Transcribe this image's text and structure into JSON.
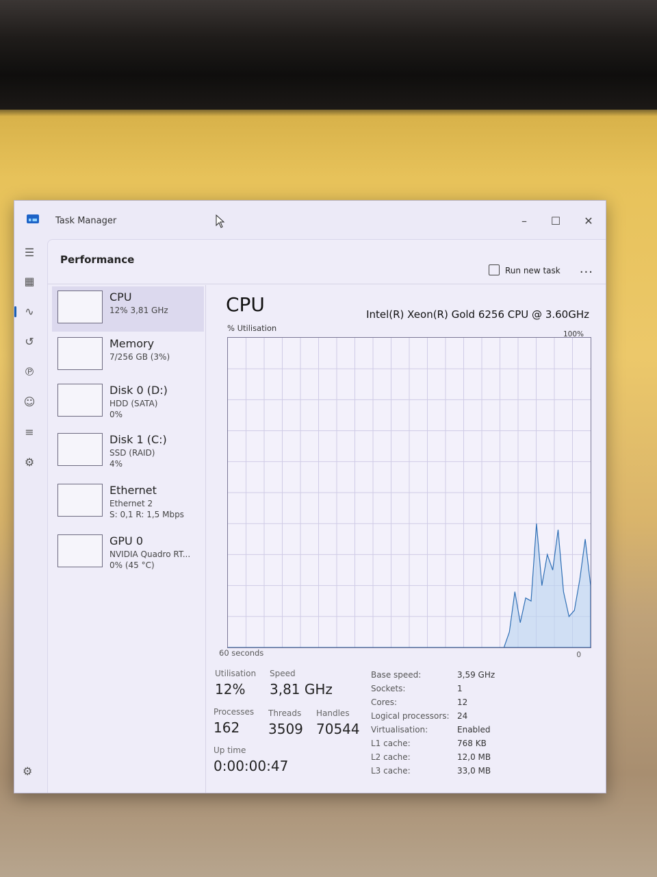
{
  "window": {
    "title": "Task Manager"
  },
  "nav": {
    "icons": [
      "hamburger-icon",
      "processes-icon",
      "performance-icon",
      "app-history-icon",
      "startup-icon",
      "users-icon",
      "details-icon",
      "services-icon",
      "settings-icon"
    ]
  },
  "header": {
    "title": "Performance",
    "run_task": "Run new task",
    "more": "..."
  },
  "resources": [
    {
      "name": "CPU",
      "line1": "12% 3,81 GHz",
      "line2": ""
    },
    {
      "name": "Memory",
      "line1": "7/256 GB (3%)",
      "line2": ""
    },
    {
      "name": "Disk 0 (D:)",
      "line1": "HDD (SATA)",
      "line2": "0%"
    },
    {
      "name": "Disk 1 (C:)",
      "line1": "SSD (RAID)",
      "line2": "4%"
    },
    {
      "name": "Ethernet",
      "line1": "Ethernet 2",
      "line2": "S: 0,1 R: 1,5 Mbps"
    },
    {
      "name": "GPU 0",
      "line1": "NVIDIA Quadro RT...",
      "line2": "0% (45 °C)"
    }
  ],
  "detail": {
    "title": "CPU",
    "model": "Intel(R) Xeon(R) Gold 6256 CPU @ 3.60GHz",
    "util_label": "% Utilisation",
    "max_label": "100%",
    "time_label": "60 seconds",
    "min_label": "0",
    "utilisation_history": [
      0,
      0,
      0,
      0,
      0,
      0,
      0,
      0,
      0,
      0,
      0,
      0,
      0,
      0,
      0,
      0,
      0,
      0,
      0,
      0,
      0,
      0,
      0,
      0,
      0,
      0,
      0,
      0,
      0,
      0,
      0,
      0,
      0,
      0,
      0,
      0,
      0,
      0,
      0,
      0,
      0,
      0,
      0,
      0,
      0,
      0,
      0,
      0,
      0,
      0,
      0,
      0,
      5,
      18,
      8,
      16,
      15,
      40,
      20,
      30,
      25,
      38,
      18,
      10,
      12,
      22,
      35,
      20
    ]
  },
  "stats": {
    "utilisation_label": "Utilisation",
    "utilisation": "12%",
    "speed_label": "Speed",
    "speed": "3,81 GHz",
    "processes_label": "Processes",
    "processes": "162",
    "threads_label": "Threads",
    "threads": "3509",
    "handles_label": "Handles",
    "handles": "70544",
    "uptime_label": "Up time",
    "uptime": "0:00:00:47"
  },
  "info": [
    {
      "label": "Base speed:",
      "value": "3,59 GHz"
    },
    {
      "label": "Sockets:",
      "value": "1"
    },
    {
      "label": "Cores:",
      "value": "12"
    },
    {
      "label": "Logical processors:",
      "value": "24"
    },
    {
      "label": "Virtualisation:",
      "value": "Enabled"
    },
    {
      "label": "L1 cache:",
      "value": "768 KB"
    },
    {
      "label": "L2 cache:",
      "value": "12,0 MB"
    },
    {
      "label": "L3 cache:",
      "value": "33,0 MB"
    }
  ]
}
